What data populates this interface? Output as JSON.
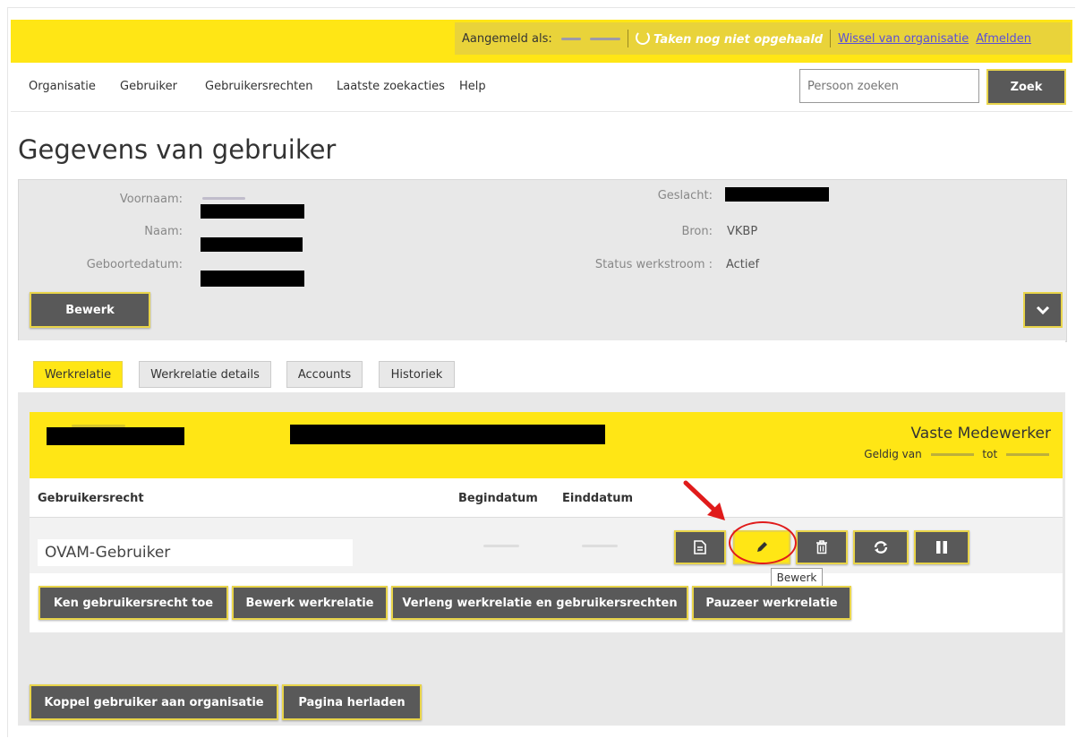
{
  "header": {
    "logged_in_label": "Aangemeld als:",
    "tasks_status": "Taken nog niet opgehaald",
    "switch_org": "Wissel van organisatie",
    "logout": "Afmelden"
  },
  "nav": {
    "items": [
      "Organisatie",
      "Gebruiker",
      "Gebruikersrechten",
      "Laatste zoekacties",
      "Help"
    ],
    "search_placeholder": "Persoon zoeken",
    "search_button": "Zoek"
  },
  "page": {
    "title": "Gegevens van gebruiker"
  },
  "details": {
    "first_name_label": "Voornaam:",
    "last_name_label": "Naam:",
    "birthdate_label": "Geboortedatum:",
    "gender_label": "Geslacht:",
    "source_label": "Bron:",
    "source_value": "VKBP",
    "workflow_label": "Status werkstroom :",
    "workflow_value": "Actief",
    "edit_button": "Bewerk"
  },
  "tabs": [
    "Werkrelatie",
    "Werkrelatie details",
    "Accounts",
    "Historiek"
  ],
  "relation": {
    "type": "Vaste Medewerker",
    "valid_from_label": "Geldig van",
    "valid_to_label": "tot",
    "columns": {
      "right": "Gebruikersrecht",
      "start": "Begindatum",
      "end": "Einddatum"
    },
    "rows": [
      {
        "right": "OVAM-Gebruiker"
      }
    ],
    "tooltip": "Bewerk",
    "buttons": {
      "assign": "Ken gebruikersrecht toe",
      "edit": "Bewerk werkrelatie",
      "extend": "Verleng werkrelatie en gebruikersrechten",
      "pause": "Pauzeer werkrelatie"
    }
  },
  "footer": {
    "link_user": "Koppel gebruiker aan organisatie",
    "reload": "Pagina herladen"
  }
}
